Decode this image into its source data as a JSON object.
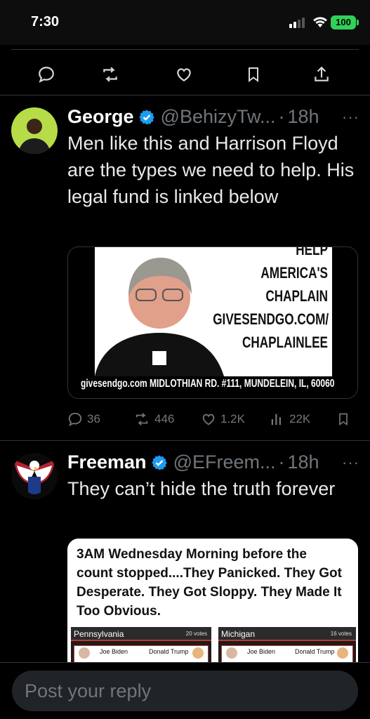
{
  "status_bar": {
    "time": "7:30",
    "battery": "100"
  },
  "colors": {
    "accent": "#1d9bf0",
    "muted": "#71767b",
    "divider": "#2f3336",
    "battery": "#30d158"
  },
  "action_icons": [
    "reply-icon",
    "retweet-icon",
    "like-icon",
    "bookmark-icon",
    "share-icon"
  ],
  "tweets": [
    {
      "name": "George",
      "handle": "@BehizyTw...",
      "time": "18h",
      "text": "Men like this and Harrison Floyd are the types we need to help. His legal fund is linked below",
      "media": {
        "lines": [
          "HELP",
          "AMERICA'S",
          "CHAPLAIN",
          "GIVESENDGO.COM/",
          "CHAPLAINLEE"
        ],
        "footer": "givesendgo.com MIDLOTHIAN RD. #111, MUNDELEIN, IL, 60060"
      },
      "stats": {
        "replies": "36",
        "retweets": "446",
        "likes": "1.2K",
        "views": "22K"
      }
    },
    {
      "name": "Freeman",
      "handle": "@EFreem...",
      "time": "18h",
      "text": "They can’t hide the truth forever",
      "media": {
        "headline": "3AM Wednesday Morning before the count stopped....They Panicked. They Got Desperate. They Got Sloppy. They Made It Too Obvious.",
        "panels": [
          {
            "state": "Pennsylvania",
            "votes": "20 votes",
            "left": "Joe Biden",
            "right": "Donald Trump"
          },
          {
            "state": "Michigan",
            "votes": "16 votes",
            "left": "Joe Biden",
            "right": "Donald Trump"
          }
        ]
      }
    }
  ],
  "reply": {
    "placeholder": "Post your reply"
  }
}
